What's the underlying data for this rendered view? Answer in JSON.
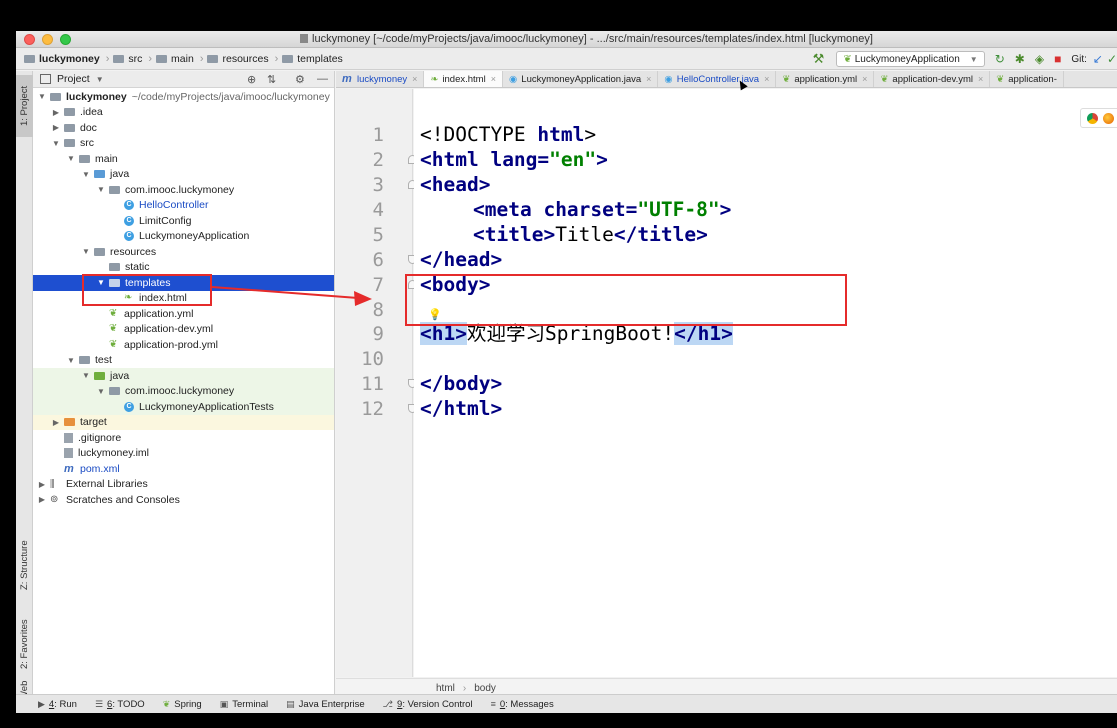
{
  "window": {
    "title": "luckymoney [~/code/myProjects/java/imooc/luckymoney] - .../src/main/resources/templates/index.html [luckymoney]"
  },
  "navbar": {
    "crumbs": [
      "luckymoney",
      "src",
      "main",
      "resources",
      "templates"
    ],
    "run_config": "LuckymoneyApplication",
    "git_label": "Git:"
  },
  "left_strip": {
    "project_tab": "1: Project",
    "structure_tab": "Z: Structure",
    "favorites_tab": "2: Favorites",
    "web_tab": "Web"
  },
  "project_panel": {
    "header": "Project",
    "tree": [
      {
        "label": "luckymoney",
        "extra": "~/code/myProjects/java/imooc/luckymoney"
      },
      {
        "label": ".idea"
      },
      {
        "label": "doc"
      },
      {
        "label": "src"
      },
      {
        "label": "main"
      },
      {
        "label": "java"
      },
      {
        "label": "com.imooc.luckymoney"
      },
      {
        "label": "HelloController"
      },
      {
        "label": "LimitConfig"
      },
      {
        "label": "LuckymoneyApplication"
      },
      {
        "label": "resources"
      },
      {
        "label": "static"
      },
      {
        "label": "templates"
      },
      {
        "label": "index.html"
      },
      {
        "label": "application.yml"
      },
      {
        "label": "application-dev.yml"
      },
      {
        "label": "application-prod.yml"
      },
      {
        "label": "test"
      },
      {
        "label": "java"
      },
      {
        "label": "com.imooc.luckymoney"
      },
      {
        "label": "LuckymoneyApplicationTests"
      },
      {
        "label": "target"
      },
      {
        "label": ".gitignore"
      },
      {
        "label": "luckymoney.iml"
      },
      {
        "label": "pom.xml"
      },
      {
        "label": "External Libraries"
      },
      {
        "label": "Scratches and Consoles"
      }
    ]
  },
  "tabs": [
    {
      "label": "luckymoney"
    },
    {
      "label": "index.html"
    },
    {
      "label": "LuckymoneyApplication.java"
    },
    {
      "label": "HelloController.java"
    },
    {
      "label": "application.yml"
    },
    {
      "label": "application-dev.yml"
    },
    {
      "label": "application-"
    }
  ],
  "editor": {
    "line_numbers": [
      "1",
      "2",
      "3",
      "4",
      "5",
      "6",
      "7",
      "8",
      "9",
      "10",
      "11",
      "12"
    ],
    "breadcrumb": [
      "html",
      "body"
    ],
    "code": {
      "l1_a": "<!DOCTYPE ",
      "l1_b": "html",
      "l1_c": ">",
      "l2_a": "<html ",
      "l2_b": "lang=",
      "l2_c": "\"en\"",
      "l2_d": ">",
      "l3": "<head>",
      "l4_a": "<meta ",
      "l4_b": "charset=",
      "l4_c": "\"UTF-8\"",
      "l4_d": ">",
      "l5_a": "<title>",
      "l5_b": "Title",
      "l5_c": "</title>",
      "l6": "</head>",
      "l7": "<body>",
      "l9_a": "<h1>",
      "l9_b": "欢迎学习SpringBoot!",
      "l9_c": "</h1>",
      "l11": "</body>",
      "l12": "</html>"
    }
  },
  "bottom_bar": [
    {
      "key": "4",
      "label": ": Run"
    },
    {
      "key": "6",
      "label": ": TODO"
    },
    {
      "key": "",
      "label": "Spring"
    },
    {
      "key": "",
      "label": "Terminal"
    },
    {
      "key": "",
      "label": "Java Enterprise"
    },
    {
      "key": "9",
      "label": ": Version Control"
    },
    {
      "key": "0",
      "label": ": Messages"
    }
  ],
  "colors": {
    "selection": "#1e4fd0",
    "annotation_red": "#e52b2b",
    "keyword": "#000080",
    "string": "#008000"
  }
}
